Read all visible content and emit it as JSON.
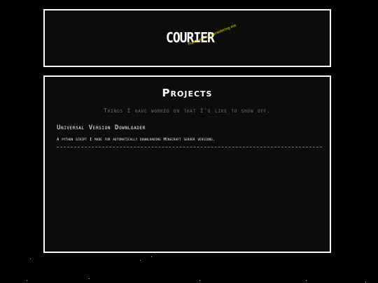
{
  "header": {
    "logo_text": "COURIER",
    "splash_text": "thank you for considering me"
  },
  "projects": {
    "title": "Projects",
    "subtitle": "Things I have worked on that I'd like to show off.",
    "items": [
      {
        "name": "Universal Version Downloader",
        "description": "A python script I made for automatically downloading Minecraft server versions."
      }
    ]
  },
  "colors": {
    "background": "#000000",
    "panel": "#0c0c0c",
    "border": "#ffffff",
    "splash": "#e8e800",
    "muted_text": "#707070"
  }
}
